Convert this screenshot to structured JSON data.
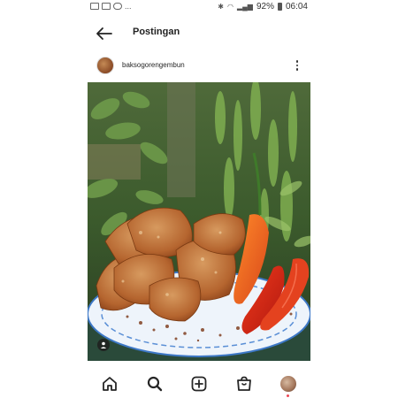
{
  "status_bar": {
    "left_icons": [
      "image-icon",
      "email-icon",
      "messenger-icon"
    ],
    "dots": "...",
    "battery": "92%",
    "time": "06:04"
  },
  "header": {
    "title": "Postingan"
  },
  "post": {
    "username": "baksogorengembun",
    "image_description": "Fried meatball chips on a blue-white plate with red chilies"
  },
  "nav": {
    "items": [
      "home-icon",
      "search-icon",
      "create-icon",
      "shop-icon",
      "profile-avatar"
    ]
  },
  "colors": {
    "accent_dot": "#ed4956",
    "text": "#262626"
  }
}
